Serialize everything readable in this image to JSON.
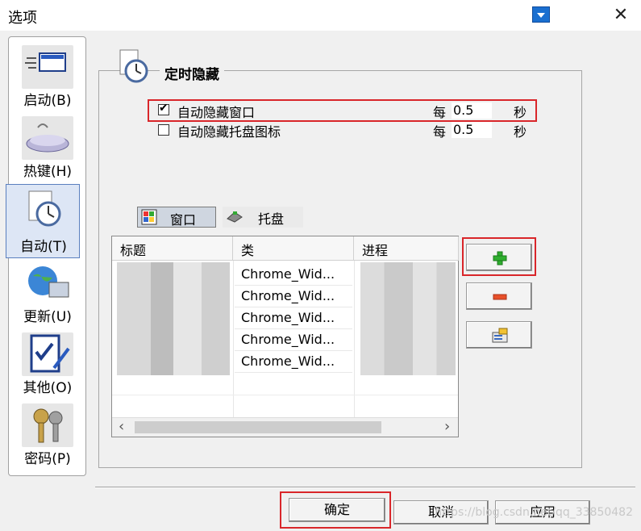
{
  "window": {
    "title": "选项",
    "close_glyph": "✕"
  },
  "sidebar": {
    "items": [
      {
        "label": "启动(B)",
        "icon": "startup-icon"
      },
      {
        "label": "热键(H)",
        "icon": "keyboard-icon"
      },
      {
        "label": "自动(T)",
        "icon": "clock-icon",
        "active": true
      },
      {
        "label": "更新(U)",
        "icon": "globe-computer-icon"
      },
      {
        "label": "其他(O)",
        "icon": "checklist-pen-icon"
      },
      {
        "label": "密码(P)",
        "icon": "keys-icon"
      }
    ]
  },
  "section": {
    "title": "定时隐藏"
  },
  "options": [
    {
      "label": "自动隐藏窗口",
      "checked": true,
      "every": "每",
      "value": "0.5",
      "unit": "秒"
    },
    {
      "label": "自动隐藏托盘图标",
      "checked": false,
      "every": "每",
      "value": "0.5",
      "unit": "秒"
    }
  ],
  "tabs": [
    {
      "label": "窗口",
      "active": true
    },
    {
      "label": "托盘",
      "active": false
    }
  ],
  "list": {
    "columns": [
      "标题",
      "类",
      "进程"
    ],
    "rows": [
      {
        "class": "Chrome_Wid..."
      },
      {
        "class": "Chrome_Wid..."
      },
      {
        "class": "Chrome_Wid..."
      },
      {
        "class": "Chrome_Wid..."
      },
      {
        "class": "Chrome_Wid..."
      }
    ],
    "scroll_left": "‹",
    "scroll_right": "›"
  },
  "footer": {
    "ok": "确定",
    "cancel": "取消",
    "apply": "应用"
  },
  "watermark": "https://blog.csdn.net/qq_33850482",
  "colors": {
    "highlight": "#d9262a",
    "add": "#2fae2f",
    "remove": "#e8502a"
  }
}
